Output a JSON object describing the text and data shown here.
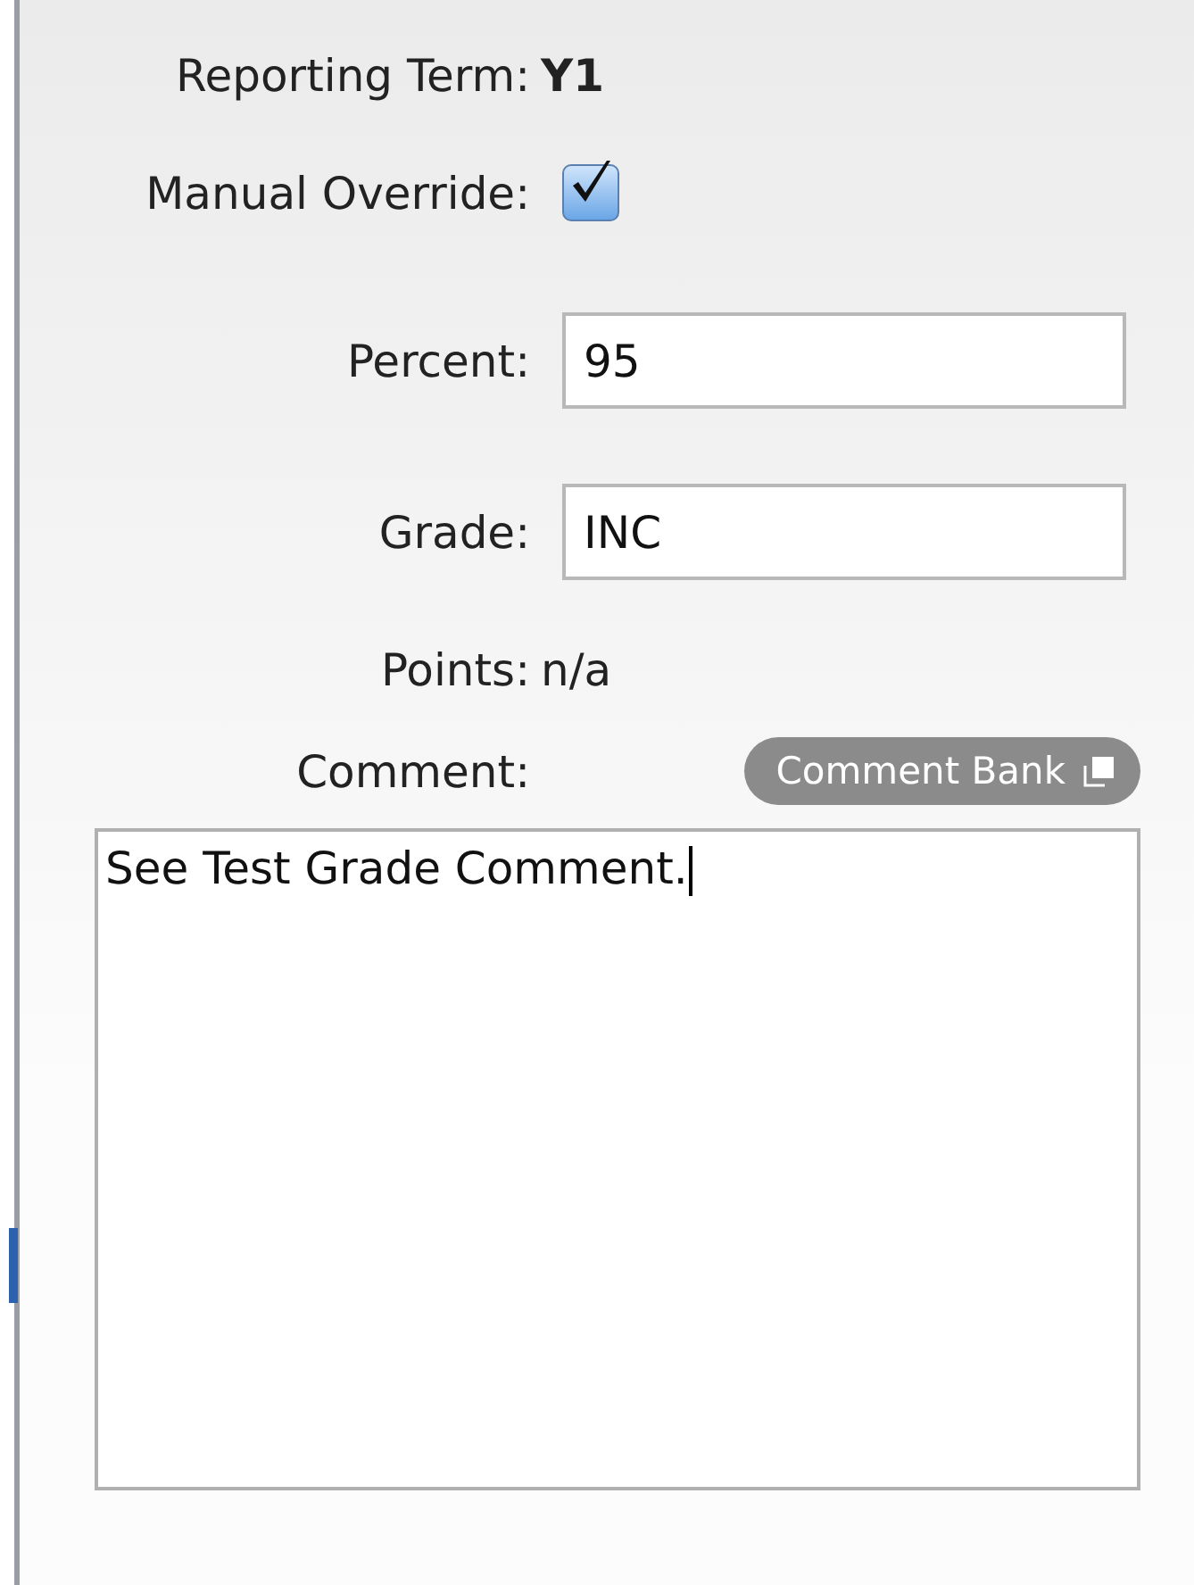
{
  "reporting_term": {
    "label": "Reporting Term:",
    "value": "Y1"
  },
  "manual_override": {
    "label": "Manual Override:",
    "checked": true
  },
  "fields": [
    {
      "label": "Percent:",
      "value": "95"
    },
    {
      "label": "Grade:",
      "value": "INC"
    }
  ],
  "points": {
    "label": "Points:",
    "value": "n/a"
  },
  "comment": {
    "label": "Comment:",
    "button": "Comment Bank",
    "value": "See Test Grade Comment."
  }
}
